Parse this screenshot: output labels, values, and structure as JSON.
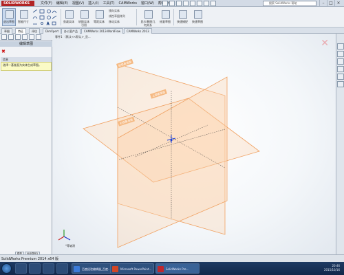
{
  "app": {
    "logo_text": "SOLIDWORKS",
    "title_menus": [
      "文件(F)",
      "编辑(E)",
      "视图(V)",
      "插入(I)",
      "工具(T)",
      "CAMWorks",
      "窗口(W)",
      "帮助(H)"
    ],
    "search_placeholder": "搜索 SolidWorks 帮助",
    "window_controls": [
      "–",
      "□",
      "×"
    ]
  },
  "ribbon": {
    "exit_sketch_label": "退出草图",
    "smart_dim_label": "智能尺寸",
    "trim_label": "剪裁实体",
    "convert_label": "转换实体引用",
    "offset_label": "等距实体",
    "mirror_label": "镜向实体",
    "linear_pattern_label": "线性草图阵列",
    "move_label": "移动实体",
    "display_delete_label": "显示/删除几何关系",
    "repair_label": "修复草图",
    "quick_snap_label": "快速捕捉",
    "rapid_sketch_label": "快速草图"
  },
  "tabs": [
    "草图",
    "特征",
    "评估",
    "DimXpert",
    "办公室产品",
    "CAMWorks 2013-WorkFlow",
    "CAMWorks 2013"
  ],
  "active_tab_index": 1,
  "panel": {
    "header": "编辑草图",
    "section": "信息",
    "message": "选择一基准面为实体生成草图。"
  },
  "viewport": {
    "breadcrumb": "零件1 （默认<<默认>_显...",
    "plane_labels": [
      "前视基准面",
      "上视基准面",
      "右视基准面"
    ],
    "view_name": "*等轴测",
    "triad_axes": [
      "X",
      "Y",
      "Z"
    ]
  },
  "colors": {
    "plane_stroke": "#f0a060",
    "plane_fill": "#fbd3b0",
    "origin_blue": "#1b3fd8",
    "taskbar": "#1e3b63"
  },
  "statusbar": {
    "text": "SolidWorks Premium 2014 x64 版",
    "bottom_tabs": [
      "模型",
      "运动算例1"
    ]
  },
  "taskbar": {
    "windows": [
      "百度经验编辑器_百度...",
      "Microsoft PowerPoint...",
      "SolidWorks Pre..."
    ],
    "time": "20:46",
    "date": "2015/10/16"
  }
}
